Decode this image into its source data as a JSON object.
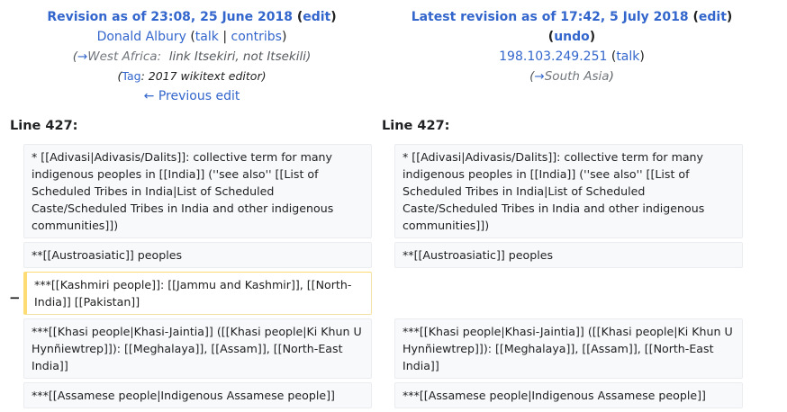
{
  "left_header": {
    "title_prefix": "Revision as of 23:08, 25 June 2018",
    "edit_label": "edit",
    "user_name": "Donald Albury",
    "talk_label": "talk",
    "separator": "|",
    "contribs_label": "contribs",
    "comment_arrow": "→",
    "comment_section": "West Africa:",
    "comment_text": "link Itsekiri, not Itsekili",
    "tag_label": "Tag",
    "tag_value": "2017 wikitext editor",
    "prev_edit_label": "← Previous edit"
  },
  "right_header": {
    "title_prefix": "Latest revision as of 17:42, 5 July 2018",
    "edit_label": "edit",
    "undo_label": "undo",
    "user_ip": "198.103.249.251",
    "talk_label": "talk",
    "comment_arrow": "→",
    "comment_section": "South Asia"
  },
  "diff": {
    "left_line_label": "Line 427:",
    "right_line_label": "Line 427:",
    "removed_marker": "−",
    "left_rows": [
      "* [[Adivasi|Adivasis/Dalits]]: collective term for many indigenous peoples in [[India]] (''see also'' [[List of Scheduled Tribes in India|List of Scheduled Caste/Scheduled Tribes in India and other indigenous communities]])",
      "**[[Austroasiatic]] peoples",
      "***[[Kashmiri people]]: [[Jammu and Kashmir]], [[North-India]] [[Pakistan]]",
      "***[[Khasi people|Khasi-Jaintia]] ([[Khasi people|Ki Khun U Hynñiewtrep]]): [[Meghalaya]], [[Assam]], [[North-East India]]",
      "***[[Assamese people|Indigenous Assamese people]]"
    ],
    "right_rows": [
      "* [[Adivasi|Adivasis/Dalits]]: collective term for many indigenous peoples in [[India]] (''see also'' [[List of Scheduled Tribes in India|List of Scheduled Caste/Scheduled Tribes in India and other indigenous communities]])",
      "**[[Austroasiatic]] peoples",
      "***[[Khasi people|Khasi-Jaintia]] ([[Khasi people|Ki Khun U Hynñiewtrep]]): [[Meghalaya]], [[Assam]], [[North-East India]]",
      "***[[Assamese people|Indigenous Assamese people]]"
    ]
  },
  "colors": {
    "link": "#3366cc",
    "context_bg": "#f8f9fa",
    "deleted_border": "#fedc74"
  }
}
